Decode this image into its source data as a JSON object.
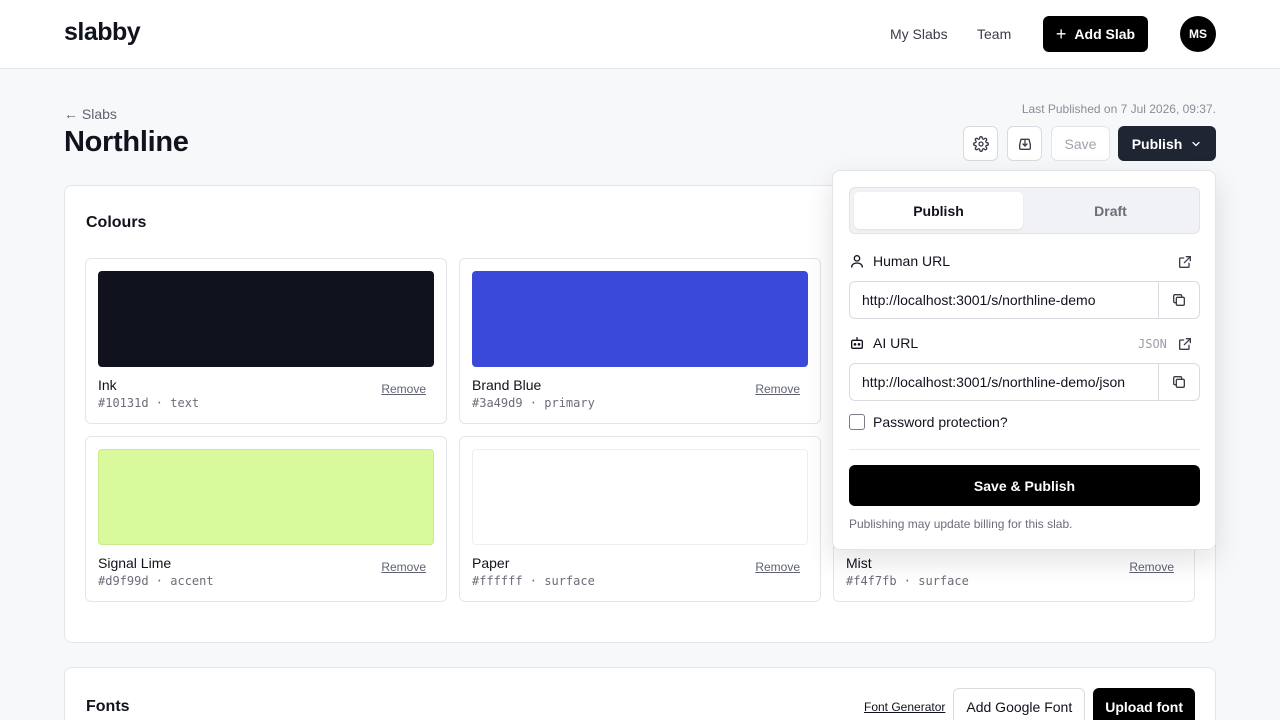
{
  "header": {
    "logo": "slabby",
    "nav": [
      {
        "label": "My Slabs"
      },
      {
        "label": "Team"
      }
    ],
    "add_slab_label": "Add Slab",
    "avatar_initials": "MS"
  },
  "page": {
    "breadcrumb": "← Slabs",
    "title": "Northline",
    "last_published": "Last Published on 7 Jul 2026, 09:37."
  },
  "toolbar": {
    "settings_icon": "gear-icon",
    "download_icon": "download-icon",
    "save_label": "Save",
    "publish_label": "Publish"
  },
  "colours": {
    "title": "Colours",
    "remove_label": "Remove",
    "items": [
      {
        "name": "Ink",
        "meta": "#10131d · text",
        "hex": "#10131d"
      },
      {
        "name": "Brand Blue",
        "meta": "#3a49d9 · primary",
        "hex": "#3a49d9"
      },
      {
        "name": "Signal Lime",
        "meta": "#d9f99d · accent",
        "hex": "#d9f99d"
      },
      {
        "name": "Paper",
        "meta": "#ffffff · surface",
        "hex": "#ffffff"
      },
      {
        "name": "Mist",
        "meta": "#f4f7fb · surface",
        "hex": "#f4f7fb"
      }
    ]
  },
  "fonts": {
    "title": "Fonts",
    "generator_label": "Font Generator",
    "add_google_label": "Add Google Font",
    "upload_label": "Upload font"
  },
  "publish_popover": {
    "tabs": [
      {
        "label": "Publish",
        "active": true
      },
      {
        "label": "Draft",
        "active": false
      }
    ],
    "human_url_label": "Human URL",
    "human_url": "http://localhost:3001/s/northline-demo",
    "ai_url_label": "AI URL",
    "ai_format": "JSON",
    "ai_url": "http://localhost:3001/s/northline-demo/json",
    "password_label": "Password protection?",
    "password_checked": false,
    "save_publish_label": "Save & Publish",
    "billing_note": "Publishing may update billing for this slab."
  }
}
